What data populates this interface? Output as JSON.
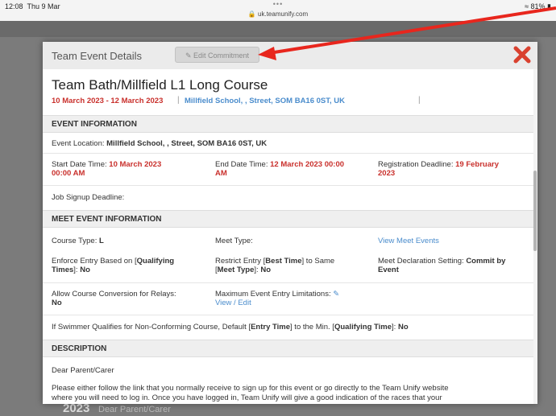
{
  "status": {
    "time": "12:08",
    "date": "Thu 9 Mar",
    "url": "uk.teamunify.com",
    "battery": "81%",
    "dots": "•••"
  },
  "background": {
    "year": "2023",
    "dear": "Dear Parent/Carer"
  },
  "modal": {
    "title": "Team Event Details",
    "edit_label": "Edit Commitment",
    "event_title": "Team Bath/Millfield L1 Long Course",
    "dates": "10 March 2023 - 12 March 2023",
    "location": "Millfield School, , Street, SOM BA16 0ST, UK"
  },
  "event_info": {
    "heading": "EVENT INFORMATION",
    "location_label": "Event Location:",
    "location_value": "Millfield School, , Street, SOM BA16 0ST, UK",
    "start_label": "Start Date Time:",
    "start_value_1": "10 March 2023",
    "start_value_2": "00:00 AM",
    "end_label": "End Date Time:",
    "end_value_1": "12 March 2023 00:00",
    "end_value_2": "AM",
    "reg_label": "Registration Deadline:",
    "reg_value_1": "19 February",
    "reg_value_2": "2023",
    "job_label": "Job Signup Deadline:"
  },
  "meet_info": {
    "heading": "MEET EVENT INFORMATION",
    "course_label": "Course Type:",
    "course_value": "L",
    "meet_type_label": "Meet Type:",
    "view_meet_events": "View Meet Events",
    "enforce_1": "Enforce Entry Based on [",
    "enforce_bold": "Qualifying",
    "enforce_2": "Times",
    "enforce_3": "]: ",
    "enforce_value": "No",
    "restrict_1": "Restrict Entry [",
    "restrict_bold": "Best Time",
    "restrict_2": "] to Same",
    "restrict_3": "[",
    "restrict_bold2": "Meet Type",
    "restrict_4": "]: ",
    "restrict_value": "No",
    "decl_label": "Meet Declaration Setting:",
    "decl_value_1": "Commit by",
    "decl_value_2": "Event",
    "allow_label": "Allow Course Conversion for Relays:",
    "allow_value": "No",
    "max_label": "Maximum Event Entry Limitations:",
    "view_edit": "View / Edit",
    "nonconf_1": "If Swimmer Qualifies for Non-Conforming Course, Default [",
    "nonconf_bold1": "Entry Time",
    "nonconf_2": "] to the Min. [",
    "nonconf_bold2": "Qualifying Time",
    "nonconf_3": "]: ",
    "nonconf_value": "No"
  },
  "description": {
    "heading": "DESCRIPTION",
    "greeting": "Dear Parent/Carer",
    "para_1": "Please either follow the link that you normally receive to sign up for this event or go directly to the Team Unify website",
    "para_2": "where you will need to log in.  Once you have logged in, Team Unify will give a good indication of the races that your"
  },
  "colors": {
    "accent_red": "#c9302c",
    "link_blue": "#4a8ccc",
    "close_red": "#d9412f",
    "arrow_red": "#e8261d"
  }
}
